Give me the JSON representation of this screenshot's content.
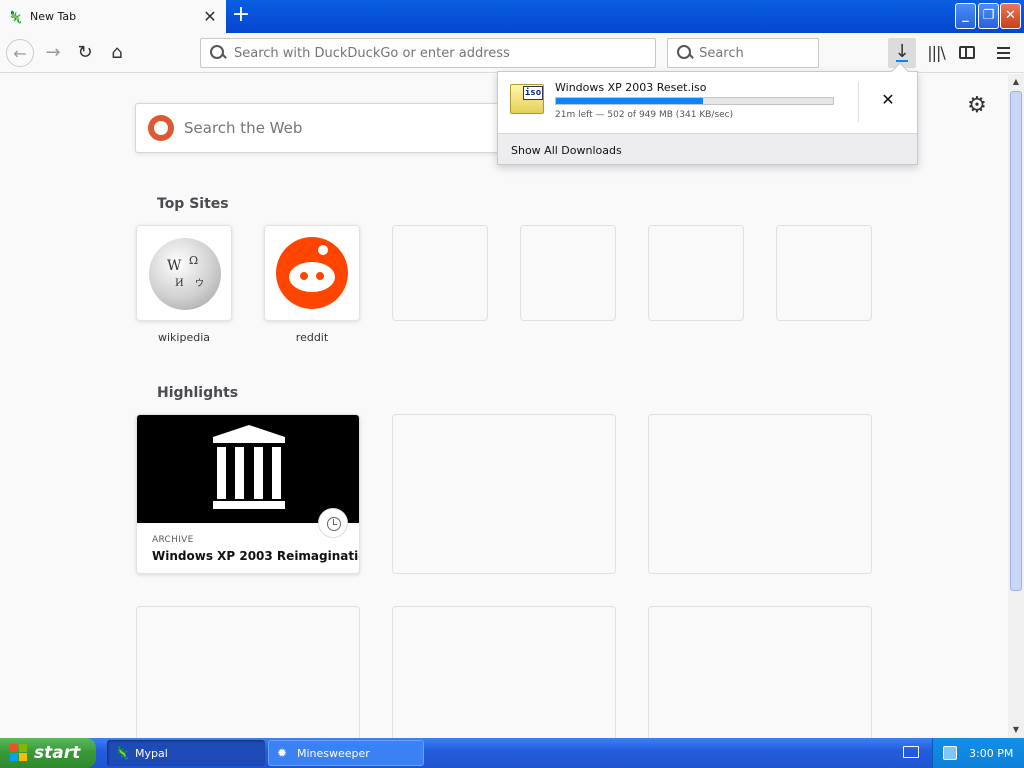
{
  "browser": {
    "tab_title": "New Tab",
    "url_placeholder": "Search with DuckDuckGo or enter address",
    "search_placeholder": "Search"
  },
  "newtab": {
    "web_search_placeholder": "Search the Web",
    "top_sites_title": "Top Sites",
    "top_sites": [
      {
        "label": "wikipedia"
      },
      {
        "label": "reddit"
      }
    ],
    "highlights_title": "Highlights",
    "highlight": {
      "source": "ARCHIVE",
      "title": "Windows XP 2003 Reimaginatio..."
    }
  },
  "downloads": {
    "file_name": "Windows XP 2003 Reset.iso",
    "file_type_tag": "iso",
    "status": "21m left — 502 of 949 MB (341 KB/sec)",
    "progress_fraction": 0.529,
    "show_all_label": "Show All Downloads"
  },
  "taskbar": {
    "start_label": "start",
    "items": [
      {
        "label": "Mypal"
      },
      {
        "label": "Minesweeper"
      }
    ],
    "clock": "3:00 PM"
  },
  "colors": {
    "accent": "#0a84ff",
    "xp_blue": "#245edc",
    "start_green": "#3a9a3a",
    "reddit": "#ff4500",
    "duckduckgo": "#de5833"
  }
}
